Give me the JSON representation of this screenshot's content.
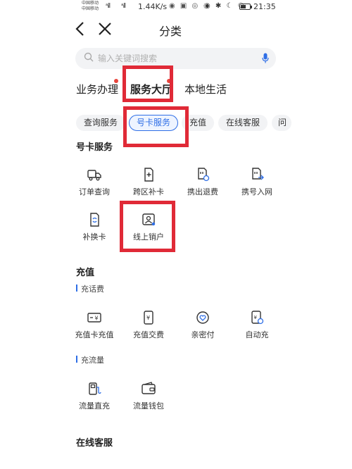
{
  "status_bar": {
    "carrier1": "中国移动",
    "carrier2": "中国移动",
    "signal1": "ᵃᵢll",
    "signal2": "ᵃᵢll",
    "speed": "1.44K/s",
    "clock": "21:35",
    "battery_level": 0.6
  },
  "nav": {
    "title": "分类"
  },
  "search": {
    "placeholder": "输入关键词搜索"
  },
  "tabs": [
    {
      "label": "业务办理"
    },
    {
      "label": "服务大厅"
    },
    {
      "label": "本地生活"
    }
  ],
  "chips": [
    {
      "label": "查询服务"
    },
    {
      "label": "号卡服务"
    },
    {
      "label": "充值"
    },
    {
      "label": "在线客服"
    },
    {
      "label": "问"
    }
  ],
  "sections": {
    "card": {
      "title": "号卡服务",
      "items": [
        {
          "label": "订单查询",
          "icon": "truck-icon"
        },
        {
          "label": "跨区补卡",
          "icon": "sim-add-icon"
        },
        {
          "label": "携出退费",
          "icon": "sim-refund-icon"
        },
        {
          "label": "携号入网",
          "icon": "sim-transfer-icon"
        },
        {
          "label": "补换卡",
          "icon": "sim-swap-icon"
        },
        {
          "label": "线上销户",
          "icon": "user-cancel-icon"
        }
      ]
    },
    "recharge": {
      "title": "充值",
      "sub1": "充话费",
      "items1": [
        {
          "label": "充值卡充值",
          "icon": "card-yuan-icon"
        },
        {
          "label": "充值交费",
          "icon": "phone-yuan-icon"
        },
        {
          "label": "亲密付",
          "icon": "heart-icon"
        },
        {
          "label": "自动充",
          "icon": "auto-recharge-icon"
        }
      ],
      "sub2": "充流量",
      "items2": [
        {
          "label": "流量直充",
          "icon": "fuel-icon"
        },
        {
          "label": "流量钱包",
          "icon": "wallet-icon"
        }
      ]
    },
    "service": {
      "title": "在线客服"
    }
  },
  "colors": {
    "accent": "#2e6ee6",
    "highlight": "#e02a37",
    "dot": "#e8453c"
  }
}
